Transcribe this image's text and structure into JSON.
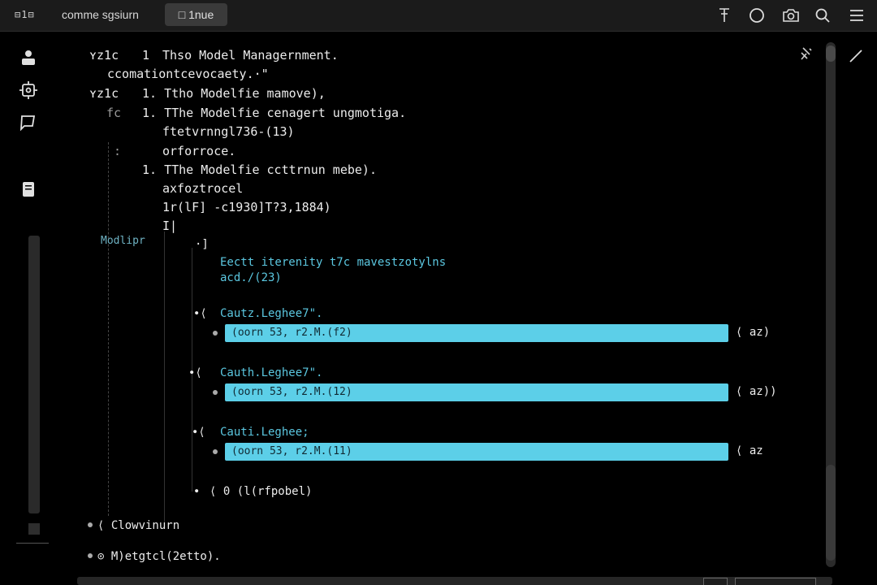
{
  "topbar": {
    "left_label": "⊟1⊟",
    "title": "comme sgsiurn",
    "tab_label": "□ 1nue"
  },
  "tree": {
    "line1_marker": "ʏz1c",
    "line1_num": "1",
    "line1_text": "Thso Model Managernment.",
    "line2_text": "ccomationtcevocaety.·\"",
    "line3_marker": "ʏz1c",
    "line3_text": "1. Ttho Modelfie mamove),",
    "line4_marker": "fc",
    "line4_text": "1. TThe Modelfie cenagert ungmotiga.",
    "line5_text": "ftetvrnngl736-(13)",
    "line6_marker": ":",
    "line6_text": "orforroce.",
    "line7_text": "1. TThe Modelfie ccttrnun mebe).",
    "line8_text": "axfoztrocel",
    "line9_text": "1r(lF] -c1930]T?3,1884)",
    "line10_text": "I|"
  },
  "section": {
    "label": "Modlipr",
    "bracket": "·]",
    "heading": "Eectt iterenity t7c mavestzotylns",
    "subheading": "acd./(23)"
  },
  "bars": [
    {
      "prefix": "∙⟨",
      "label": "Cautz.Leghee7\".",
      "text": "(oorn 53, r2.M.(f2)",
      "suffix": "⟨ az)"
    },
    {
      "prefix": "∙⟨",
      "label": "Cauth.Leghee7\".",
      "text": "(oorn 53, r2.M.(12)",
      "suffix": "⟨ az))"
    },
    {
      "prefix": "∙⟨",
      "label": "Cauti.Leghee;",
      "text": "(oorn 53, r2.M.(11)",
      "suffix": "⟨ az"
    }
  ],
  "footer_row": {
    "marker": "∙",
    "text": "⟨ 0 (l(rfpobel)"
  },
  "bottom_items": [
    {
      "text": "⟨ Clowvinurn"
    },
    {
      "text": "⊙ M)etgtcl(2etto)."
    }
  ]
}
